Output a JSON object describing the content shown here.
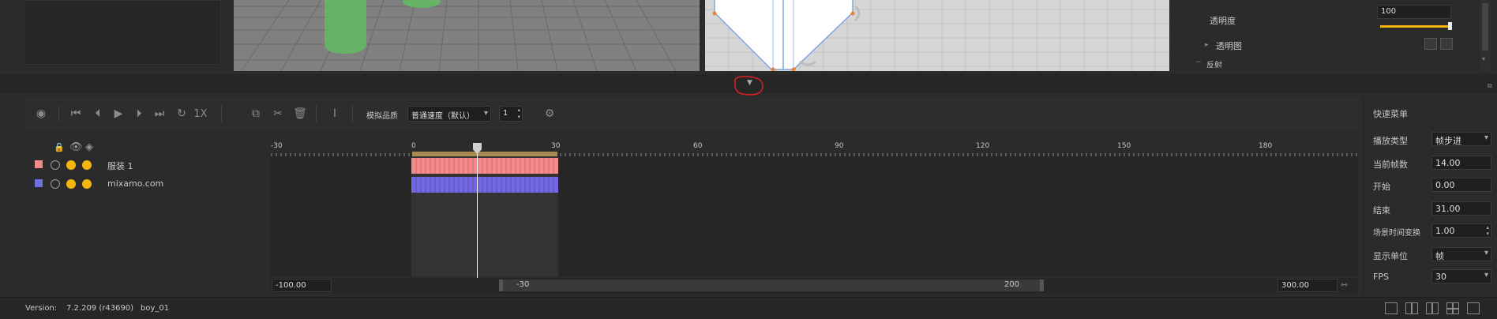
{
  "properties": {
    "opacity_label": "透明度",
    "opacity_value": "100",
    "opacity_map_label": "透明图",
    "next_section_label": "反射"
  },
  "toolbar": {
    "speed_label": "1X",
    "sim_quality_label": "模拟品质",
    "sim_quality_value": "普通速度（默认）",
    "step_value": "1"
  },
  "tracks": [
    {
      "name": "服装 1",
      "color": "#f08a8a"
    },
    {
      "name": "mixamo.com",
      "color": "#7070e0"
    }
  ],
  "ruler": {
    "ticks": [
      "-30",
      "0",
      "30",
      "60",
      "90",
      "120",
      "150",
      "180"
    ]
  },
  "timeline": {
    "left_value": "-100.00",
    "range_start": "-30",
    "range_end": "200",
    "right_value": "300.00"
  },
  "quick_menu": {
    "title": "快速菜单",
    "rows": [
      {
        "label": "播放类型",
        "value": "帧步进",
        "select": true
      },
      {
        "label": "当前帧数",
        "value": "14.00",
        "select": false
      },
      {
        "label": "开始",
        "value": "0.00",
        "select": false
      },
      {
        "label": "结束",
        "value": "31.00",
        "select": false
      },
      {
        "label": "场景时间变换",
        "value": "1.00",
        "select": false
      },
      {
        "label": "显示单位",
        "value": "帧",
        "select": true
      },
      {
        "label": "FPS",
        "value": "30",
        "select": true
      }
    ]
  },
  "status": {
    "version_label": "Version:",
    "version_value": "7.2.209 (r43690)",
    "project_name": "boy_01"
  },
  "colors": {
    "accent_yellow": "#f5b50e",
    "clip_pink": "#f4898a",
    "clip_blue": "#7468e0",
    "annotation_red": "#e02020"
  }
}
